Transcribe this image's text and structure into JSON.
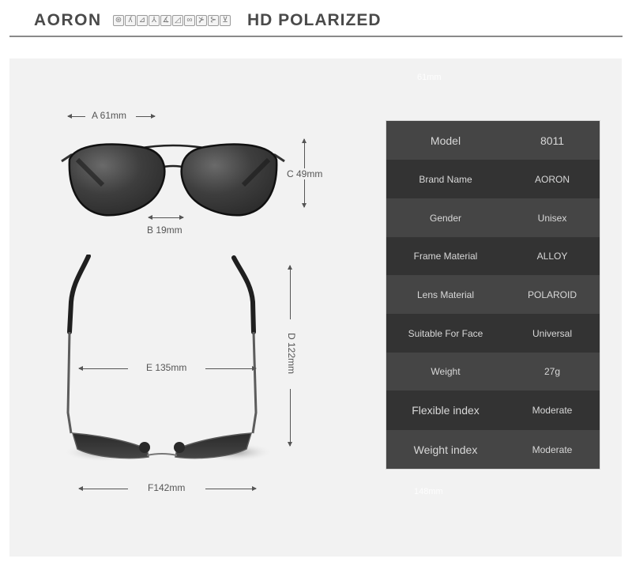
{
  "header": {
    "brand": "AORON",
    "tagline": "HD POLARIZED",
    "sport_icons": [
      {
        "name": "driving-icon",
        "glyph": "⊛"
      },
      {
        "name": "running-icon",
        "glyph": "🏃"
      },
      {
        "name": "sailing-icon",
        "glyph": "⛵"
      },
      {
        "name": "skiing-icon",
        "glyph": "⛷"
      },
      {
        "name": "climbing-icon",
        "glyph": "🧗"
      },
      {
        "name": "fishing-icon",
        "glyph": "🎣"
      },
      {
        "name": "cycling-icon",
        "glyph": "🚲"
      },
      {
        "name": "skating-icon",
        "glyph": "⛸"
      },
      {
        "name": "snowboard-icon",
        "glyph": "🏂"
      },
      {
        "name": "golf-icon",
        "glyph": "⛳"
      }
    ]
  },
  "ghost_labels": {
    "top": "61mm",
    "bottom": "148mm"
  },
  "dimensions": {
    "a": "A 61mm",
    "b": "B 19mm",
    "c": "C 49mm",
    "d": "D 122mm",
    "e": "E 135mm",
    "f": "F142mm"
  },
  "specs": [
    {
      "label": "Model",
      "value": "8011"
    },
    {
      "label": "Brand Name",
      "value": "AORON"
    },
    {
      "label": "Gender",
      "value": "Unisex"
    },
    {
      "label": "Frame Material",
      "value": "ALLOY"
    },
    {
      "label": "Lens Material",
      "value": "POLAROID"
    },
    {
      "label": "Suitable For Face",
      "value": "Universal"
    },
    {
      "label": "Weight",
      "value": "27g"
    },
    {
      "label": "Flexible index",
      "value": "Moderate"
    },
    {
      "label": "Weight index",
      "value": "Moderate"
    }
  ]
}
